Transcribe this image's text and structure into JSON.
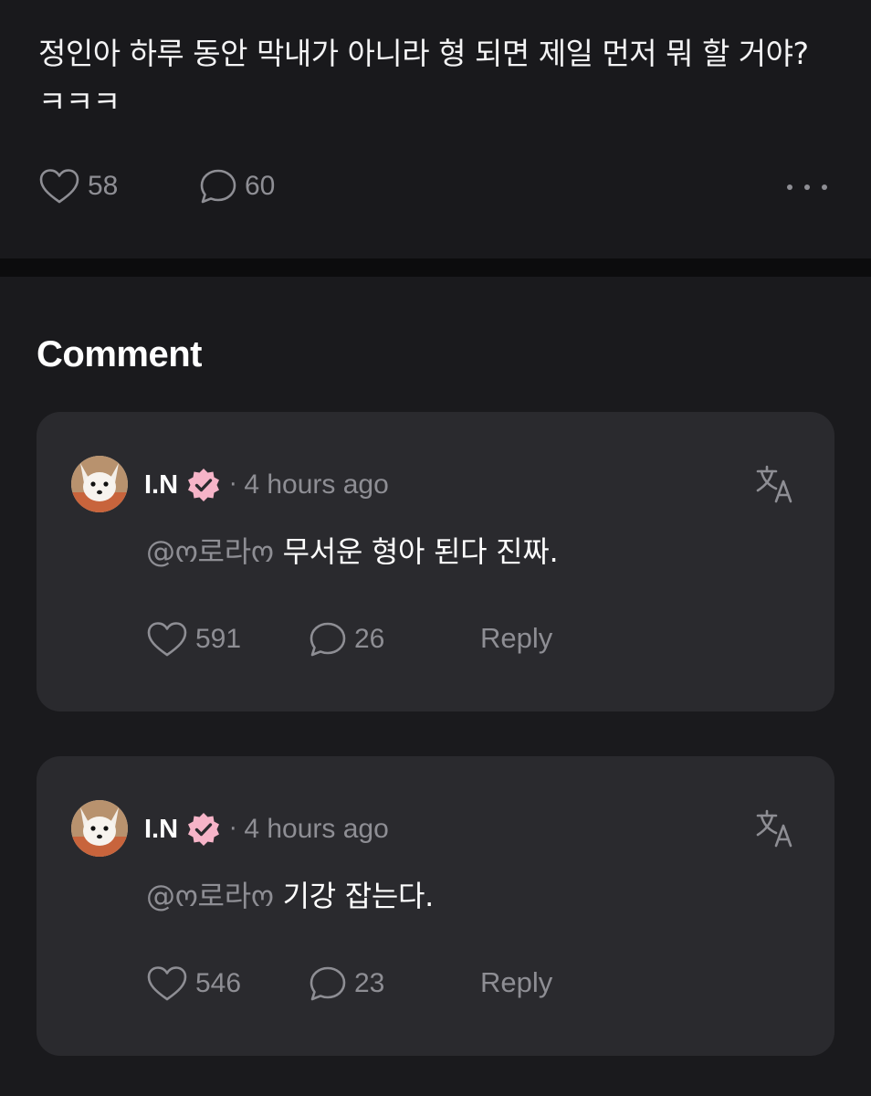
{
  "post": {
    "text": "정인아 하루 동안 막내가 아니라 형 되면 제일 먼저 뭐 할 거야?ㅋㅋㅋ",
    "likes": "58",
    "comments": "60",
    "like_icon": "heart-icon",
    "comment_icon": "speech-bubble-icon",
    "more_icon": "ellipsis-icon"
  },
  "section": {
    "title": "Comment"
  },
  "comments": [
    {
      "author": "I.N",
      "separator": "·",
      "time": "4 hours ago",
      "mention": "@ო로라ო",
      "text": " 무서운 형아 된다 진짜.",
      "likes": "591",
      "replies": "26",
      "reply_label": "Reply",
      "verified_color": "#f6b4c8",
      "translate_icon": "translate-icon"
    },
    {
      "author": "I.N",
      "separator": "·",
      "time": "4 hours ago",
      "mention": "@ო로라ო",
      "text": " 기강 잡는다.",
      "likes": "546",
      "replies": "23",
      "reply_label": "Reply",
      "verified_color": "#f6b4c8",
      "translate_icon": "translate-icon"
    }
  ],
  "colors": {
    "background": "#1a1a1d",
    "card": "#2a2a2e",
    "muted_text": "#8e8e94",
    "text": "#ffffff",
    "verified_badge": "#f6b4c8"
  }
}
